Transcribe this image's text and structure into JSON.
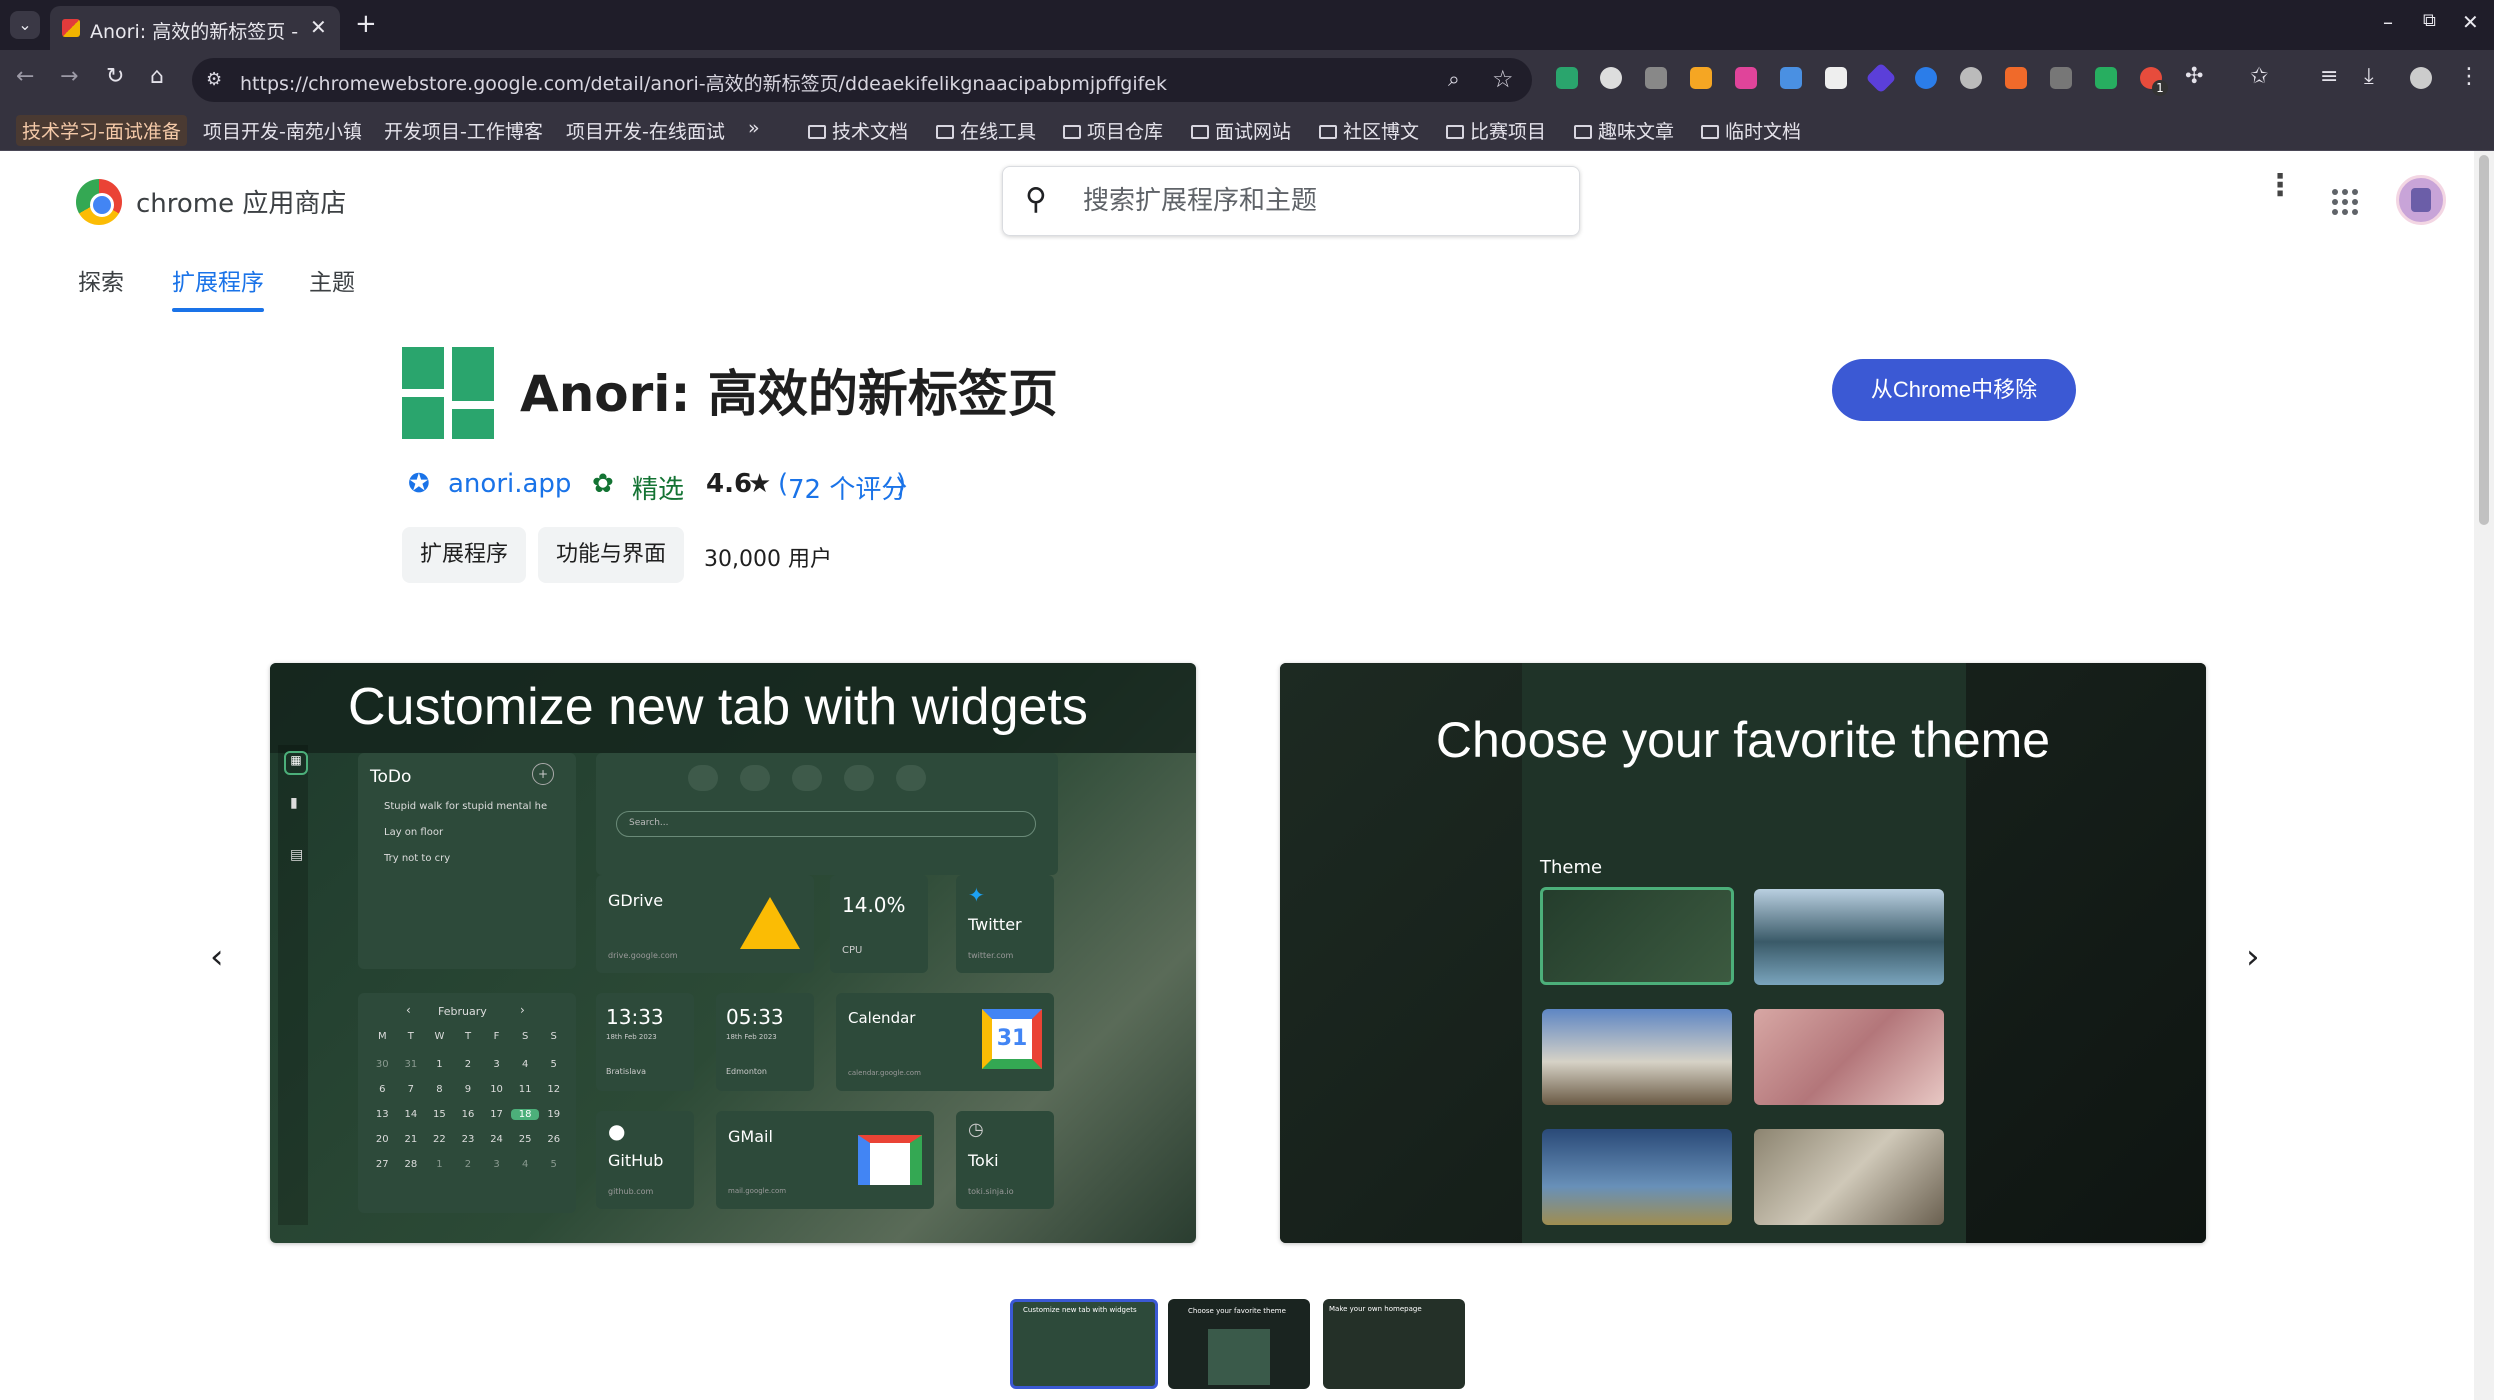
{
  "browser": {
    "tab_title": "Anori: 高效的新标签页 - C",
    "url": "https://chromewebstore.google.com/detail/anori-高效的新标签页/ddeaekifelikgnaacipabpmjpffgifek",
    "bookmarks": [
      "技术学习-面试准备",
      "项目开发-南苑小镇",
      "开发项目-工作博客",
      "项目开发-在线面试"
    ],
    "more_bookmarks": "»",
    "folders": [
      "技术文档",
      "在线工具",
      "项目仓库",
      "面试网站",
      "社区博文",
      "比赛项目",
      "趣味文章",
      "临时文档"
    ],
    "extension_badge": "1"
  },
  "store": {
    "name": "chrome 应用商店",
    "search_placeholder": "搜索扩展程序和主题",
    "nav_tabs": [
      "探索",
      "扩展程序",
      "主题"
    ]
  },
  "extension": {
    "title": "Anori: 高效的新标签页",
    "remove_button": "从Chrome中移除",
    "publisher": "anori.app",
    "featured": "精选",
    "rating": "4.6",
    "rating_star": "★",
    "rating_open": "(",
    "reviews": "72 个评分",
    "rating_close": ")",
    "chips": [
      "扩展程序",
      "功能与界面"
    ],
    "users": "30,000 用户"
  },
  "screenshots": {
    "shot1": {
      "heading": "Customize new tab with widgets",
      "todo_title": "ToDo",
      "todo_plus": "+",
      "todo_items": [
        "Stupid walk for stupid mental he",
        "Lay on floor",
        "Try not to cry"
      ],
      "search_placeholder": "Search...",
      "gdrive": "GDrive",
      "gdrive_url": "drive.google.com",
      "cpu_value": "14.0%",
      "cpu_label": "CPU",
      "twitter": "Twitter",
      "twitter_url": "twitter.com",
      "cal_prev": "‹",
      "cal_next": "›",
      "month": "February",
      "weekdays": [
        "M",
        "T",
        "W",
        "T",
        "F",
        "S",
        "S"
      ],
      "days": [
        "30",
        "31",
        "1",
        "2",
        "3",
        "4",
        "5",
        "6",
        "7",
        "8",
        "9",
        "10",
        "11",
        "12",
        "13",
        "14",
        "15",
        "16",
        "17",
        "18",
        "19",
        "20",
        "21",
        "22",
        "23",
        "24",
        "25",
        "26",
        "27",
        "28",
        "1",
        "2",
        "3",
        "4",
        "5"
      ],
      "clock1_time": "13:33",
      "clock1_date": "18th Feb 2023",
      "clock1_city": "Bratislava",
      "clock2_time": "05:33",
      "clock2_date": "18th Feb 2023",
      "clock2_city": "Edmonton",
      "calendar": "Calendar",
      "calendar_url": "calendar.google.com",
      "calendar_day": "31",
      "github": "GitHub",
      "github_url": "github.com",
      "gmail": "GMail",
      "gmail_url": "mail.google.com",
      "toki": "Toki",
      "toki_url": "toki.sinja.io"
    },
    "shot2": {
      "heading": "Choose your favorite theme",
      "theme_label": "Theme"
    },
    "thumb1_caption": "Customize new tab with widgets",
    "thumb2_caption": "Choose your favorite theme",
    "thumb3_caption": "Make your own homepage"
  },
  "colors": {
    "accent": "#1a73e8",
    "button": "#3b59d4",
    "widget_bg": "#2d4a3a",
    "featured": "#137333"
  }
}
